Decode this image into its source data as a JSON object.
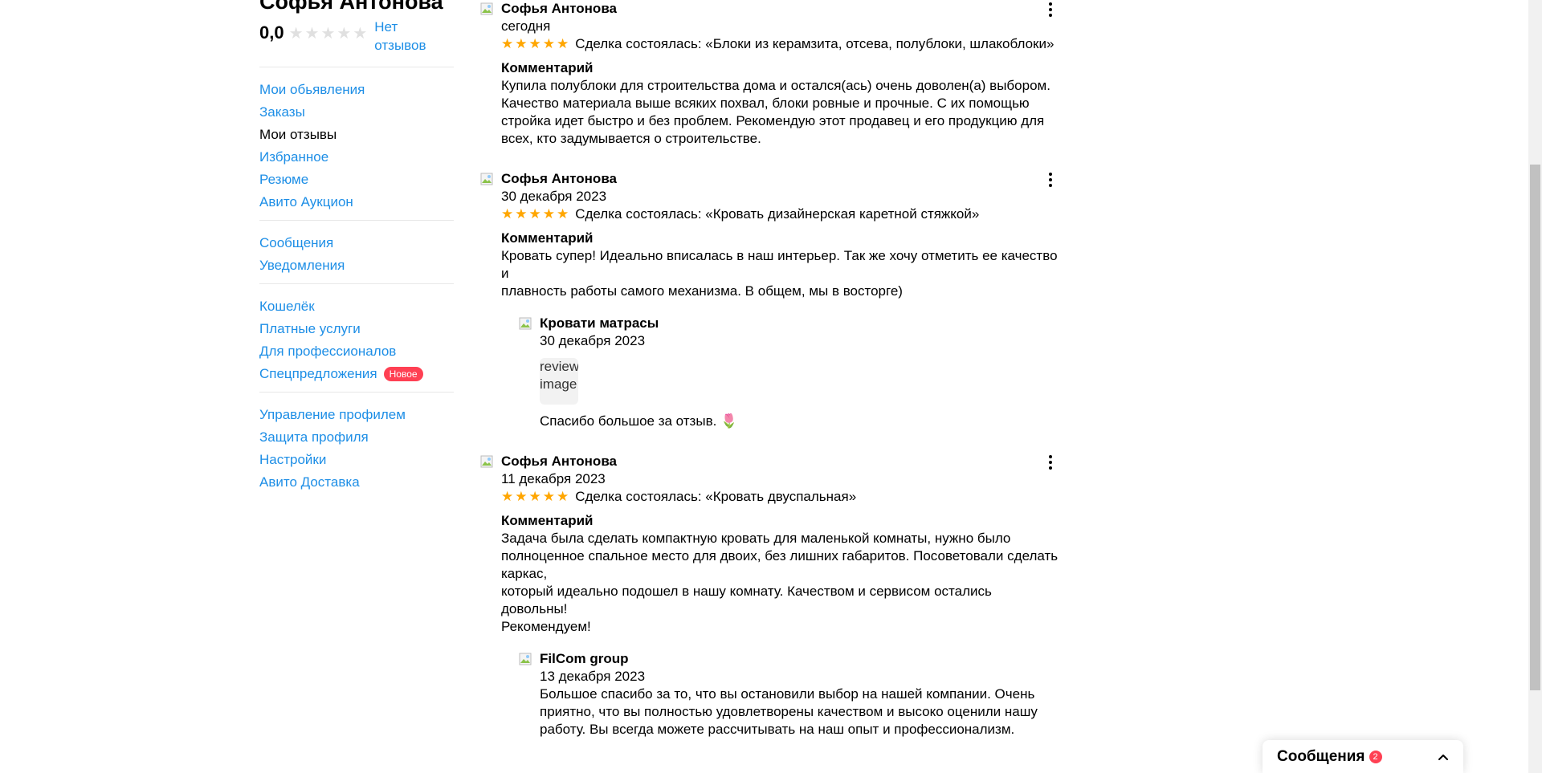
{
  "profile": {
    "name": "Софья Антонова",
    "rating": "0,0",
    "no_reviews": "Нет отзывов"
  },
  "sidebar": {
    "group1": [
      {
        "label": "Мои обьявления"
      },
      {
        "label": "Заказы"
      },
      {
        "label": "Мои отзывы"
      },
      {
        "label": "Избранное"
      },
      {
        "label": "Резюме"
      },
      {
        "label": "Авито Аукцион"
      }
    ],
    "group2": [
      {
        "label": "Сообщения"
      },
      {
        "label": "Уведомления"
      }
    ],
    "group3": [
      {
        "label": "Кошелёк"
      },
      {
        "label": "Платные услуги"
      },
      {
        "label": "Для профессионалов"
      },
      {
        "label": "Спецпредложения",
        "badge": "Новое"
      }
    ],
    "group4": [
      {
        "label": "Управление профилем"
      },
      {
        "label": "Защита профиля"
      },
      {
        "label": "Настройки"
      },
      {
        "label": "Авито Доставка"
      }
    ]
  },
  "reviews": [
    {
      "author": "Софья Антонова",
      "date": "сегодня",
      "stars": 5,
      "deal": "Сделка состоялась: «Блоки из керамзита, отсева, полублоки, шлакоблоки»",
      "comment_title": "Комментарий",
      "text": "Купила полублоки для строительства дома и остался(ась) очень доволен(а) выбором.\nКачество материала выше всяких похвал, блоки ровные и прочные. С их помощью\nстройка идет быстро и без проблем. Рекомендую этот продавец и его продукцию для\nвсех, кто задумывается о строительстве."
    },
    {
      "author": "Софья Антонова",
      "date": "30 декабря 2023",
      "stars": 5,
      "deal": "Сделка состоялась: «Кровать дизайнерская каретной стяжкой»",
      "comment_title": "Комментарий",
      "text": "Кровать супер! Идеально вписалась в наш интерьер. Так же хочу отметить ее качество и\nплавность работы самого механизма. В общем, мы в восторге)",
      "reply": {
        "author": "Кровати матрасы",
        "date": "30 декабря 2023",
        "image_alt": "review image",
        "text": "Спасибо большое за отзыв. 🌷"
      }
    },
    {
      "author": "Софья Антонова",
      "date": "11 декабря 2023",
      "stars": 5,
      "deal": "Сделка состоялась: «Кровать двуспальная»",
      "comment_title": "Комментарий",
      "text": "Задача была сделать компактную кровать для маленькой комнаты, нужно было\nполноценное спальное место для двоих, без лишних габаритов. Посоветовали сделать\nкаркас,\nкоторый идеально подошел в нашу комнату. Качеством и сервисом остались довольны!\nРекомендуем!",
      "reply": {
        "author": "FilCom group",
        "date": "13 декабря 2023",
        "text": "Большое спасибо за то, что вы остановили выбор на нашей компании. Очень\nприятно, что вы полностью удовлетворены качеством и высоко оценили нашу\nработу. Вы всегда можете рассчитывать на наш опыт и профессионализм."
      }
    }
  ],
  "messenger": {
    "title": "Сообщения",
    "count": "2"
  },
  "colors": {
    "link": "#1d8ee6",
    "star": "#ffa600",
    "badge": "#ff4053"
  }
}
